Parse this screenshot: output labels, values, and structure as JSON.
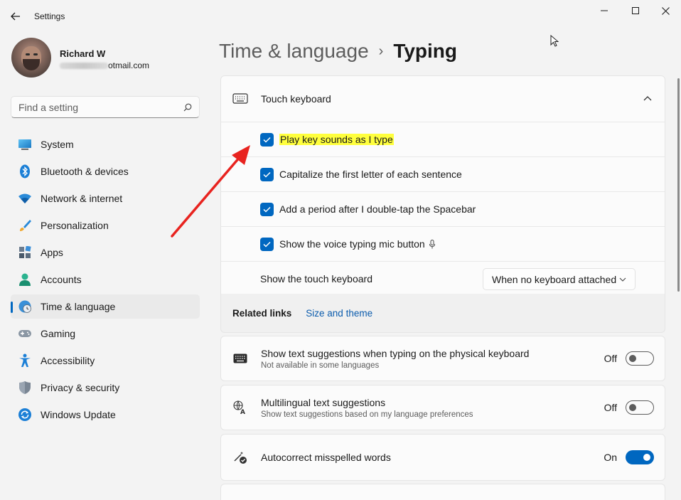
{
  "window": {
    "title": "Settings"
  },
  "profile": {
    "name": "Richard W",
    "email_visible": "otmail.com"
  },
  "search": {
    "placeholder": "Find a setting"
  },
  "nav": {
    "items": [
      {
        "label": "System",
        "icon": "system-icon"
      },
      {
        "label": "Bluetooth & devices",
        "icon": "bluetooth-icon"
      },
      {
        "label": "Network & internet",
        "icon": "wifi-icon"
      },
      {
        "label": "Personalization",
        "icon": "brush-icon"
      },
      {
        "label": "Apps",
        "icon": "apps-icon"
      },
      {
        "label": "Accounts",
        "icon": "person-icon"
      },
      {
        "label": "Time & language",
        "icon": "globe-clock-icon",
        "active": true
      },
      {
        "label": "Gaming",
        "icon": "gamepad-icon"
      },
      {
        "label": "Accessibility",
        "icon": "accessibility-icon"
      },
      {
        "label": "Privacy & security",
        "icon": "shield-icon"
      },
      {
        "label": "Windows Update",
        "icon": "update-icon"
      }
    ]
  },
  "header": {
    "parent": "Time & language",
    "separator": "›",
    "current": "Typing"
  },
  "touch_keyboard": {
    "title": "Touch keyboard",
    "options": [
      {
        "label": "Play key sounds as I type",
        "checked": true,
        "highlighted": true
      },
      {
        "label": "Capitalize the first letter of each sentence",
        "checked": true
      },
      {
        "label": "Add a period after I double-tap the Spacebar",
        "checked": true
      },
      {
        "label": "Show the voice typing mic button",
        "checked": true
      }
    ],
    "show_keyboard_label": "Show the touch keyboard",
    "show_keyboard_value": "When no keyboard attached"
  },
  "related": {
    "label": "Related links",
    "link": "Size and theme"
  },
  "settings": [
    {
      "title": "Show text suggestions when typing on the physical keyboard",
      "subtitle": "Not available in some languages",
      "state": "Off"
    },
    {
      "title": "Multilingual text suggestions",
      "subtitle": "Show text suggestions based on my language preferences",
      "state": "Off"
    },
    {
      "title": "Autocorrect misspelled words",
      "subtitle": "",
      "state": "On"
    }
  ],
  "colors": {
    "accent": "#0067c0",
    "highlight": "#ffff3d",
    "arrow": "#e8231f"
  }
}
